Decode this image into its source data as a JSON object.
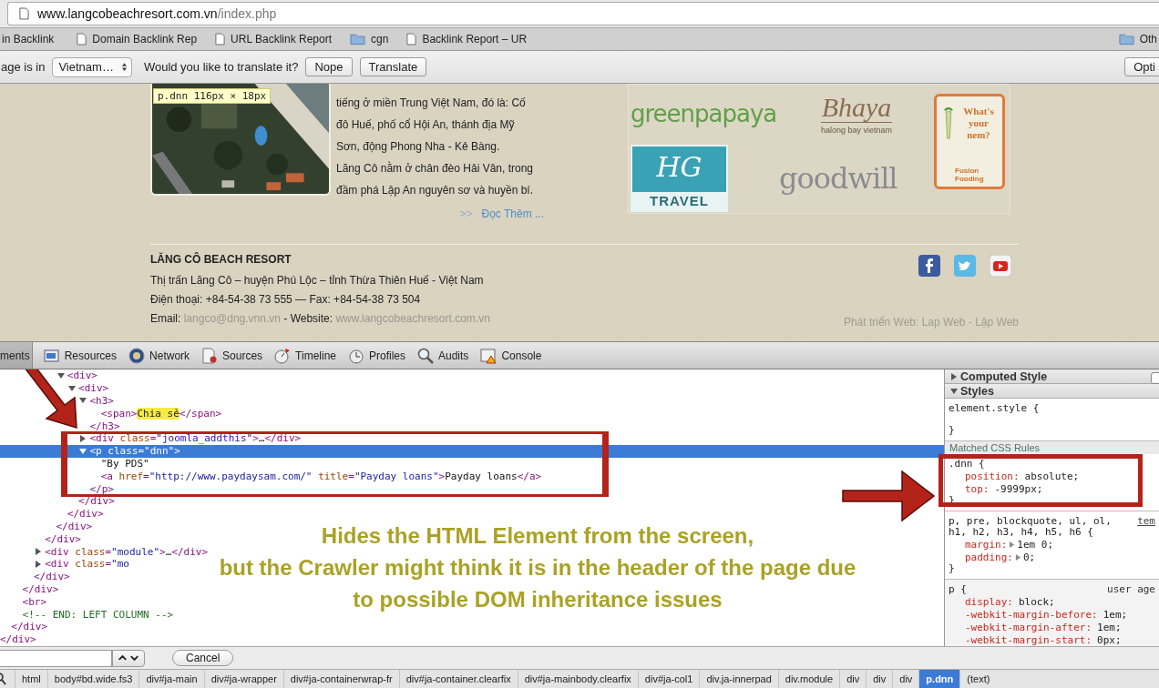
{
  "address_bar": {
    "host": "www.langcobeachresort.com.vn",
    "path": "/index.php"
  },
  "bookmarks": [
    {
      "kind": "plain",
      "label": "in Backlink"
    },
    {
      "kind": "page",
      "label": "Domain Backlink Rep"
    },
    {
      "kind": "page",
      "label": "URL Backlink Report"
    },
    {
      "kind": "folder",
      "label": "cgn"
    },
    {
      "kind": "page",
      "label": "Backlink Report – UR"
    },
    {
      "kind": "folder",
      "label": "Oth"
    }
  ],
  "translate_bar": {
    "prefix": "age is in",
    "language": "Vietnam…",
    "question": "Would you like to translate it?",
    "buttons": [
      "Nope",
      "Translate"
    ],
    "options_button": "Opti"
  },
  "page": {
    "tooltip": "p.dnn 116px × 18px",
    "article_lines": [
      "tiếng ở miền Trung Việt Nam, đó là: Cố",
      "đô Huế, phố cổ Hội An, thánh địa Mỹ",
      "Sơn, động Phong Nha - Kẻ Bàng.",
      "Lăng Cô nằm ở chân đèo Hải Vân, trong",
      "đầm phá Lập An nguyên sơ và huyền bí."
    ],
    "read_more": {
      "marker": ">>",
      "label": "Đọc Thêm ..."
    },
    "partners": [
      {
        "kind": "greenpapaya",
        "lines": [
          "greenpapaya"
        ]
      },
      {
        "kind": "bhaya",
        "lines": [
          "Bhaya",
          "halong bay vietnam"
        ]
      },
      {
        "kind": "nem",
        "lines": [
          "What's your nem?",
          "Fusion Fooding"
        ]
      },
      {
        "kind": "hg",
        "lines": [
          "HG",
          "TRAVEL"
        ]
      },
      {
        "kind": "goodwill",
        "lines": [
          "goodwill"
        ]
      }
    ],
    "footer": {
      "title": "LĂNG CÔ BEACH RESORT",
      "address": "Thị trấn Lăng Cô – huyện Phú Lộc – tỉnh Thừa Thiên Huế - Việt Nam",
      "phone": "Điện thoại: +84-54-38 73 555 — Fax: +84-54-38 73 504",
      "contact": [
        {
          "kind": "label",
          "text": "Email:"
        },
        {
          "kind": "link",
          "text": "langco@dng.vnn.vn"
        },
        {
          "kind": "label",
          "text": "- Website:"
        },
        {
          "kind": "link",
          "text": "www.langcobeachresort.com.vn"
        }
      ],
      "credit": "Phát triển Web: Lap Web - Lập Web"
    }
  },
  "devtools": {
    "tabs": [
      {
        "kind": "elements",
        "label": "ments",
        "selected": true
      },
      {
        "kind": "resources",
        "label": "Resources",
        "selected": false
      },
      {
        "kind": "network",
        "label": "Network",
        "selected": false
      },
      {
        "kind": "sources",
        "label": "Sources",
        "selected": false
      },
      {
        "kind": "timeline",
        "label": "Timeline",
        "selected": false
      },
      {
        "kind": "profiles",
        "label": "Profiles",
        "selected": false
      },
      {
        "kind": "audits",
        "label": "Audits",
        "selected": false
      },
      {
        "kind": "console",
        "label": "Console",
        "selected": false
      }
    ],
    "dom": {
      "close": "</div>",
      "children": [
        {
          "close": "</div>",
          "children": [
            {
              "close": "</div>",
              "children": [
                {
                  "close": "</div>",
                  "children": [
                    {
                      "close": "</div>",
                      "children": [
                        {
                          "close": "</div>",
                          "children": [
                            {
                              "kind": "element",
                              "open": [
                                {
                                  "kind": "tag",
                                  "text": "<div>"
                                }
                              ],
                              "expanded": true,
                              "selected": false,
                              "close": "</div>",
                              "children": [
                                {
                                  "kind": "element",
                                  "open": [
                                    {
                                      "kind": "tag",
                                      "text": "<div>"
                                    }
                                  ],
                                  "expanded": true,
                                  "selected": false,
                                  "close": "</div>",
                                  "children": [
                                    {
                                      "kind": "element",
                                      "open": [
                                        {
                                          "kind": "tag",
                                          "text": "<h3>"
                                        }
                                      ],
                                      "expanded": true,
                                      "selected": false,
                                      "close": "</h3>",
                                      "children": [
                                        {
                                          "open": [
                                            {
                                              "kind": "tag",
                                              "text": "<span>"
                                            },
                                            {
                                              "kind": "match",
                                              "text": "Chia sẻ"
                                            },
                                            {
                                              "kind": "tag",
                                              "text": "</span>"
                                            }
                                          ],
                                          "selected": false
                                        }
                                      ]
                                    },
                                    {
                                      "kind": "element",
                                      "open": [
                                        {
                                          "kind": "tag",
                                          "text": "<div "
                                        },
                                        {
                                          "kind": "attr",
                                          "text": "class"
                                        },
                                        {
                                          "kind": "tag",
                                          "text": "="
                                        },
                                        {
                                          "kind": "val",
                                          "text": "\"joomla_addthis\""
                                        },
                                        {
                                          "kind": "tag",
                                          "text": ">"
                                        },
                                        {
                                          "kind": "text",
                                          "text": "…"
                                        },
                                        {
                                          "kind": "tag",
                                          "text": "</div>"
                                        }
                                      ],
                                      "expanded": false,
                                      "selected": false
                                    },
                                    {
                                      "kind": "element",
                                      "open": [
                                        {
                                          "kind": "tag",
                                          "text": "<p "
                                        },
                                        {
                                          "kind": "attr",
                                          "text": "class"
                                        },
                                        {
                                          "kind": "tag",
                                          "text": "="
                                        },
                                        {
                                          "kind": "val",
                                          "text": "\"dnn\""
                                        },
                                        {
                                          "kind": "tag",
                                          "text": ">"
                                        }
                                      ],
                                      "expanded": true,
                                      "selected": true,
                                      "close": "</p>",
                                      "children": [
                                        {
                                          "open": [
                                            {
                                              "kind": "text",
                                              "text": "\"By PDS\""
                                            }
                                          ]
                                        },
                                        {
                                          "open": [
                                            {
                                              "kind": "tag",
                                              "text": "<a "
                                            },
                                            {
                                              "kind": "attr",
                                              "text": "href"
                                            },
                                            {
                                              "kind": "tag",
                                              "text": "="
                                            },
                                            {
                                              "kind": "val",
                                              "text": "\"http://www.paydaysam.com/\" "
                                            },
                                            {
                                              "kind": "attr",
                                              "text": "title"
                                            },
                                            {
                                              "kind": "tag",
                                              "text": "="
                                            },
                                            {
                                              "kind": "val",
                                              "text": "\"Payday loans\""
                                            },
                                            {
                                              "kind": "tag",
                                              "text": ">"
                                            },
                                            {
                                              "kind": "text",
                                              "text": "Payday loans"
                                            },
                                            {
                                              "kind": "tag",
                                              "text": "</a>"
                                            }
                                          ],
                                          "selected": false
                                        }
                                      ]
                                    }
                                  ]
                                }
                              ]
                            }
                          ]
                        }
                      ]
                    },
                    {
                      "kind": "element",
                      "open": [
                        {
                          "kind": "tag",
                          "text": "<div "
                        },
                        {
                          "kind": "attr",
                          "text": "class"
                        },
                        {
                          "kind": "tag",
                          "text": "="
                        },
                        {
                          "kind": "val",
                          "text": "\"module\""
                        },
                        {
                          "kind": "tag",
                          "text": ">"
                        },
                        {
                          "kind": "text",
                          "text": "…"
                        },
                        {
                          "kind": "tag",
                          "text": "</div>"
                        }
                      ],
                      "expanded": false,
                      "selected": false
                    },
                    {
                      "kind": "element",
                      "open": [
                        {
                          "kind": "tag",
                          "text": "<div "
                        },
                        {
                          "kind": "attr",
                          "text": "class"
                        },
                        {
                          "kind": "tag",
                          "text": "="
                        },
                        {
                          "kind": "val",
                          "text": "\"mo"
                        }
                      ],
                      "expanded": false,
                      "selected": false
                    }
                  ]
                }
              ]
            },
            {
              "open": [
                {
                  "kind": "tag",
                  "text": "<br>"
                }
              ],
              "selected": false
            },
            {
              "open": [
                {
                  "kind": "comment",
                  "text": "<!-- END: LEFT COLUMN -->"
                }
              ]
            }
          ]
        }
      ]
    },
    "styles": {
      "computed": {
        "label": "Computed Style",
        "expanded": false,
        "checked": false
      },
      "styles": {
        "label": "Styles",
        "expanded": true
      },
      "element_style": {
        "open": "element.style {",
        "close": "}"
      },
      "matched_label": "Matched CSS Rules",
      "rules": [
        {
          "selector": [
            ".dnn {"
          ],
          "props": [
            {
              "name": "position:",
              "value": "absolute;",
              "expandable": false
            },
            {
              "name": "top:",
              "value": "-9999px;",
              "expandable": false
            }
          ],
          "close": "}"
        },
        {
          "selector": [
            "p, pre, blockquote, ul, ol,",
            "h1, h2, h3, h4, h5, h6 {"
          ],
          "source": "tem",
          "source_underlined": true,
          "props": [
            {
              "name": "margin:",
              "value": "1em 0;",
              "expandable": true
            },
            {
              "name": "padding:",
              "value": "0;",
              "expandable": true
            }
          ],
          "close": "}"
        },
        {
          "selector": [
            "p {"
          ],
          "source": "user age",
          "source_underlined": false,
          "props": [
            {
              "name": "display:",
              "value": "block;",
              "expandable": false
            },
            {
              "name": "-webkit-margin-before:",
              "value": "1em;",
              "expandable": false
            },
            {
              "name": "-webkit-margin-after:",
              "value": "1em;",
              "expandable": false
            },
            {
              "name": "-webkit-margin-start:",
              "value": "0px;",
              "expandable": false
            }
          ]
        }
      ]
    },
    "cancel_button": "Cancel",
    "breadcrumbs": [
      {
        "label": "html",
        "selected": false
      },
      {
        "label": "body#bd.wide.fs3",
        "selected": false
      },
      {
        "label": "div#ja-main",
        "selected": false
      },
      {
        "label": "div#ja-wrapper",
        "selected": false
      },
      {
        "label": "div#ja-containerwrap-fr",
        "selected": false
      },
      {
        "label": "div#ja-container.clearfix",
        "selected": false
      },
      {
        "label": "div#ja-mainbody.clearfix",
        "selected": false
      },
      {
        "label": "div#ja-col1",
        "selected": false
      },
      {
        "label": "div.ja-innerpad",
        "selected": false
      },
      {
        "label": "div.module",
        "selected": false
      },
      {
        "label": "div",
        "selected": false
      },
      {
        "label": "div",
        "selected": false
      },
      {
        "label": "div",
        "selected": false
      },
      {
        "label": "p.dnn",
        "selected": true
      },
      {
        "label": "(text)",
        "selected": false
      }
    ]
  },
  "callout": [
    "Hides the HTML Element from the screen,",
    "but the Crawler might think it is in the header of the page due",
    "to possible DOM inheritance issues"
  ]
}
